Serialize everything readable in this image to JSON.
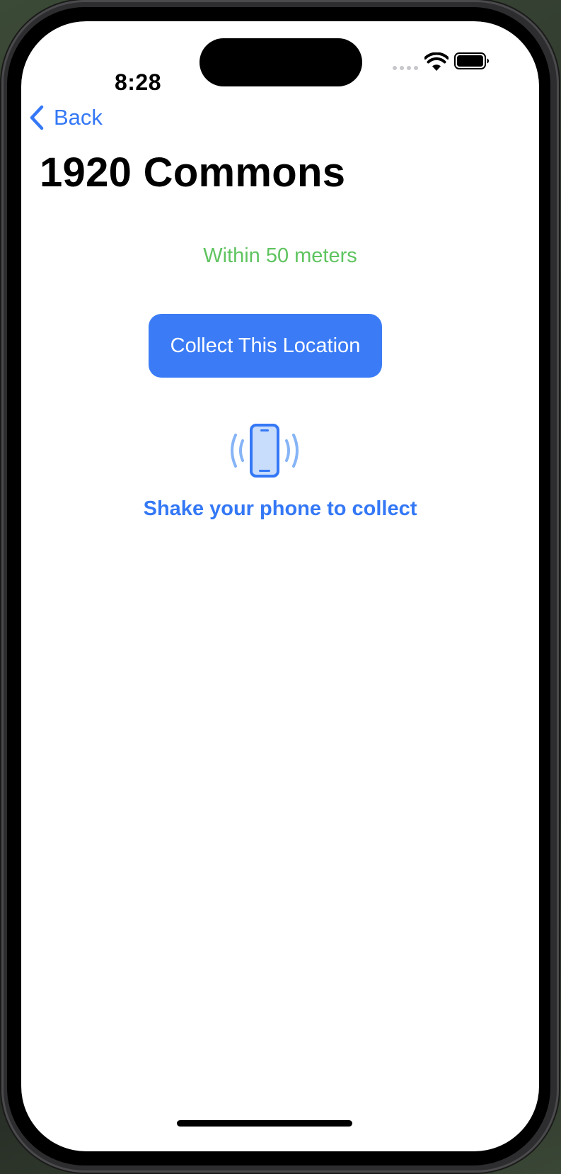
{
  "status_bar": {
    "time": "8:28",
    "wifi_icon": "wifi-icon",
    "battery_icon": "battery-icon"
  },
  "nav": {
    "back_label": "Back",
    "back_icon": "chevron-left-icon"
  },
  "page": {
    "title": "1920 Commons",
    "distance_status": "Within 50 meters",
    "collect_button_label": "Collect This Location",
    "shake_icon": "iphone-radiowaves-icon",
    "shake_hint": "Shake your phone to collect"
  },
  "colors": {
    "accent": "#3478F6",
    "button_bg": "#3B7CF6",
    "success_green": "#5FC460"
  }
}
